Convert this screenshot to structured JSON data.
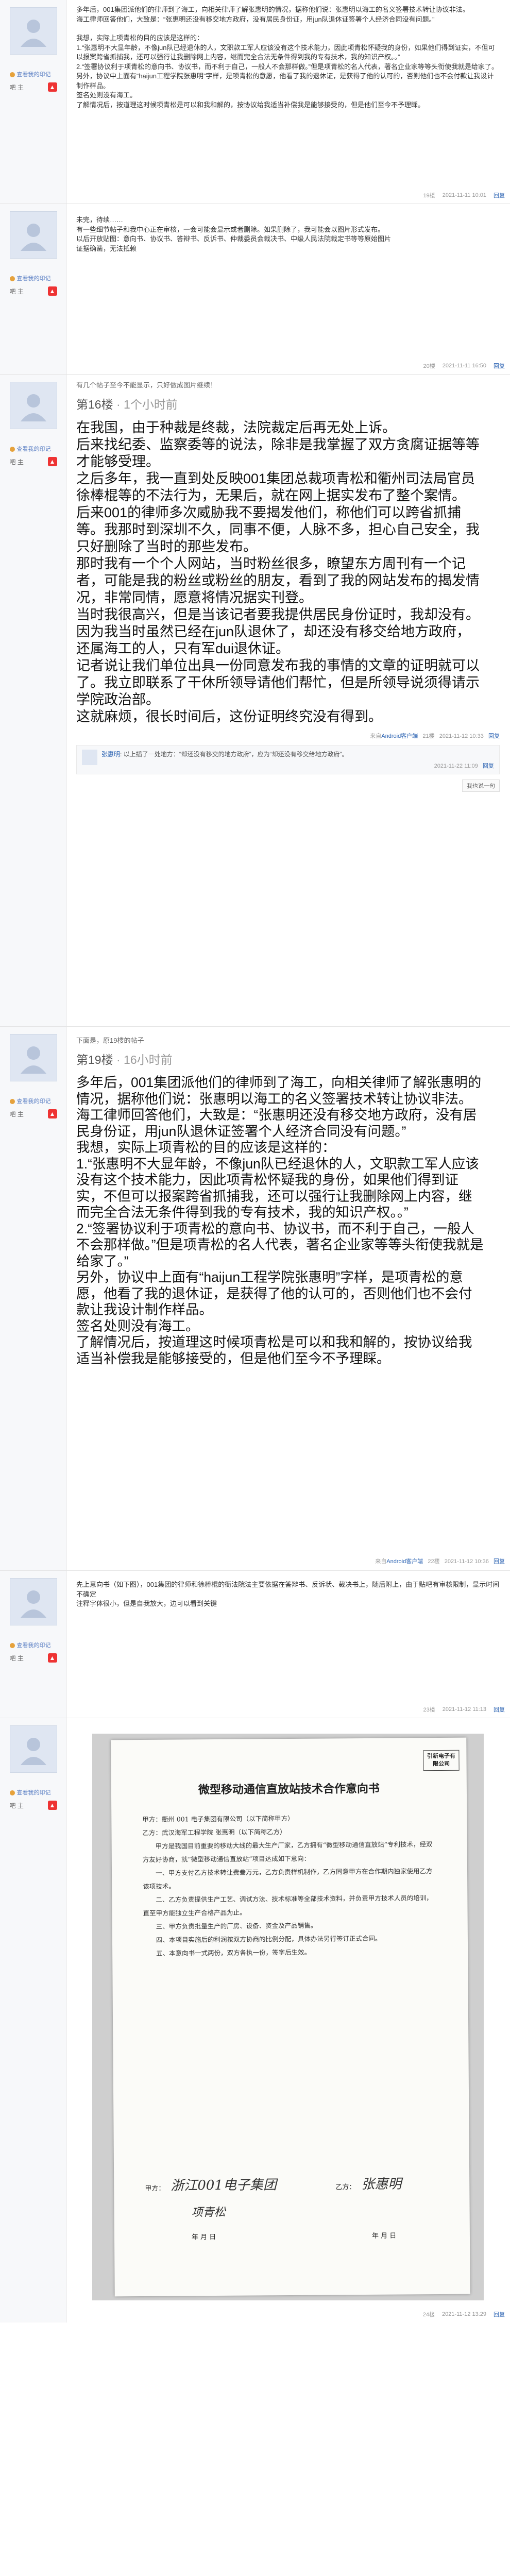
{
  "colors": {
    "link": "#2d64b3",
    "meta": "#999999",
    "sidebar": "#f7f8fa"
  },
  "posts": [
    {
      "author": {
        "name": "",
        "badge": "查看我的印记",
        "level": "吧 主"
      },
      "paragraphs": [
        "多年后，001集团派他们的律师到了海工，向相关律师了解张惠明的情况，据称他们说：张惠明以海工的名义签署技术转让协议非法。",
        "海工律师回答他们，大致是：“张惠明还没有移交地方政府，没有居民身份证，用jun队退休证签署个人经济合同没有问题。”",
        "",
        "我想，实际上项青松的目的应该是这样的：",
        "1.“张惠明不大显年龄，不像jun队已经退休的人，文职款工军人应该没有这个技术能力，因此项青松怀疑我的身份，如果他们得到证实，不但可以报案跨省抓捕我，还可以强行让我删除网上内容，继而完全合法无条件得到我的专有技术，我的知识产权。。”",
        "2.“签署协议利于项青松的意向书、协议书，而不利于自己，一般人不会那样做。”但是项青松的名人代表，著名企业家等等头衔使我就是给家了。",
        "另外，协议中上面有“haijun工程学院张惠明”字样，是项青松的意愿，他看了我的退休证，是获得了他的认可的，否则他们也不会付款让我设计制作样品。",
        "签名处则没有海工。",
        "了解情况后，按道理这时候项青松是可以和我和解的，按协议给我适当补偿我是能够接受的，但是他们至今不予理睬。"
      ],
      "footer": {
        "client": "",
        "floor": "19楼",
        "time": "2021-11-11 10:01",
        "reply": "回复"
      }
    },
    {
      "author": {
        "name": "",
        "badge": "查看我的印记",
        "level": "吧 主"
      },
      "paragraphs": [
        "未完，待续……",
        "有一些细节帖子和我中心正在审核，一会可能会显示或者删除。如果删除了，我可能会以图片形式发布。",
        "以后开放贴图：意向书、协议书、答辩书、反诉书、仲裁委员会裁决书、中级人民法院裁定书等等原始图片",
        "证据确凿，无法抵赖"
      ],
      "footer": {
        "client": "",
        "floor": "20楼",
        "time": "2021-11-11 16:50",
        "reply": "回复"
      }
    },
    {
      "author": {
        "name": "",
        "badge": "查看我的印记",
        "level": "吧 主"
      },
      "quote": {
        "text": "有几个帖子至今不能显示，只好做成图片继续！"
      },
      "floorhead": {
        "main": "第16楼",
        "sub": "· 1个小时前"
      },
      "big": [
        "在我国，由于种裁是终裁，法院裁定后再无处上诉。",
        "后来找纪委、监察委等的说法，除非是我掌握了双方贪腐证据等等才能够受理。",
        "之后多年，我一直到处反映001集团总裁项青松和衢州司法局官员徐棒棍等的不法行为，无果后，就在网上据实发布了整个案情。",
        "后来001的律师多次威胁我不要揭发他们，称他们可以跨省抓捕等。我那时到深圳不久，同事不便，人脉不多，担心自己安全，我只好删除了当时的那些发布。",
        "那时我有一个个人网站，当时粉丝很多，瞭望东方周刊有一个记者，可能是我的粉丝或粉丝的朋友，看到了我的网站发布的揭发情况，非常同情，愿意将情况据实刊登。",
        "当时我很高兴，但是当该记者要我提供居民身份证时，我却没有。因为我当时虽然已经在jun队退休了，却还没有移交给地方政府，还属海工的人，只有军dui退休证。",
        "记者说让我们单位出具一份同意发布我的事情的文章的证明就可以了。我立即联系了干休所领导请他们帮忙，但是所领导说须得请示学院政治部。",
        "这就麻烦，很长时间后，这份证明终究没有得到。"
      ],
      "src": {
        "prefix": "来自",
        "client": "Android客户端",
        "floor": "21楼",
        "time": "2021-11-12 10:33",
        "reply": "回复"
      },
      "subreply": {
        "user": "张惠明",
        "text": "以上插了一处地方：“却还没有移交的地方政府”，应为“却还没有移交给地方政府”。",
        "time": "2021-11-22 11:09",
        "action": "回复"
      },
      "want": "我也说一句"
    },
    {
      "author": {
        "name": "",
        "badge": "查看我的印记",
        "level": "吧 主"
      },
      "quote": {
        "text": "下面是，原19楼的帖子"
      },
      "floorhead": {
        "main": "第19楼",
        "sub": "· 16小时前"
      },
      "big": [
        "多年后，001集团派他们的律师到了海工，向相关律师了解张惠明的情况，据称他们说：张惠明以海工的名义签署技术转让协议非法。",
        "海工律师回答他们，大致是：“张惠明还没有移交地方政府，没有居民身份证，用jun队退休证签署个人经济合同没有问题。”",
        "我想，实际上项青松的目的应该是这样的：",
        "1.“张惠明不大显年龄，不像jun队已经退休的人，文职款工军人应该没有这个技术能力，因此项青松怀疑我的身份，如果他们得到证实，不但可以报案跨省抓捕我，还可以强行让我删除网上内容，继而完全合法无条件得到我的专有技术，我的知识产权。。”",
        "2.“签署协议利于项青松的意向书、协议书，而不利于自己，一般人不会那样做。”但是项青松的名人代表，著名企业家等等头衔使我就是给家了。”",
        "另外，协议中上面有“haijun工程学院张惠明”字样，是项青松的意愿，他看了我的退休证，是获得了他的认可的，否则他们也不会付款让我设计制作样品。",
        "签名处则没有海工。",
        "了解情况后，按道理这时候项青松是可以和我和解的，按协议给我适当补偿我是能够接受的，但是他们至今不予理睬。"
      ],
      "src": {
        "prefix": "来自",
        "client": "Android客户端",
        "floor": "22楼",
        "time": "2021-11-12 10:36",
        "reply": "回复"
      }
    },
    {
      "author": {
        "name": "",
        "badge": "查看我的印记",
        "level": "吧 主"
      },
      "paragraphs": [
        "先上意向书（如下图），001集团的律师和徐棒棍的衙法院法主要依据在答辩书、反诉状、裁决书上，随后附上，由于贴吧有审核限制，显示时间不确定",
        "注释字体很小，但是自我放大，边可以看到关键"
      ],
      "footer": {
        "client": "",
        "floor": "23楼",
        "time": "2021-11-12 11:13",
        "reply": "回复"
      }
    },
    {
      "author": {
        "name": "",
        "badge": "查看我的印记",
        "level": "吧 主"
      },
      "doc": {
        "title": "微型移动通信直放站技术合作意向书",
        "stamp": "引新电子有限公司",
        "lines": [
          "甲方：衢州 001 电子集团有限公司（以下简称甲方）",
          "乙方：武汉海军工程学院 张惠明（以下简称乙方）",
          "甲方是我国目前重要的移动大线的最大生产厂家，乙方拥有“微型移动通信直放站”专利技术，经双方友好协商，就“微型移动通信直放站”项目达成如下意向：",
          "一、甲方支付乙方技术转让费叁万元，乙方负责样机制作，乙方同意甲方在合作期内独家使用乙方该项技术。",
          "二、乙方负责提供生产工艺、调试方法、技术标准等全部技术资料，并负责甲方技术人员的培训，直至甲方能独立生产合格产品为止。",
          "三、甲方负责批量生产的厂房、设备、资金及产品销售。",
          "四、本项目实施后的利润按双方协商的比例分配，具体办法另行签订正式合同。",
          "五、本意向书一式两份，双方各执一份，签字后生效。"
        ],
        "party_a": "甲方：",
        "party_b": "乙方：",
        "date_a": "年 月 日",
        "date_b": "年 月 日"
      },
      "footer": {
        "client": "",
        "floor": "24楼",
        "time": "2021-11-12 13:29",
        "reply": "回复"
      }
    }
  ]
}
